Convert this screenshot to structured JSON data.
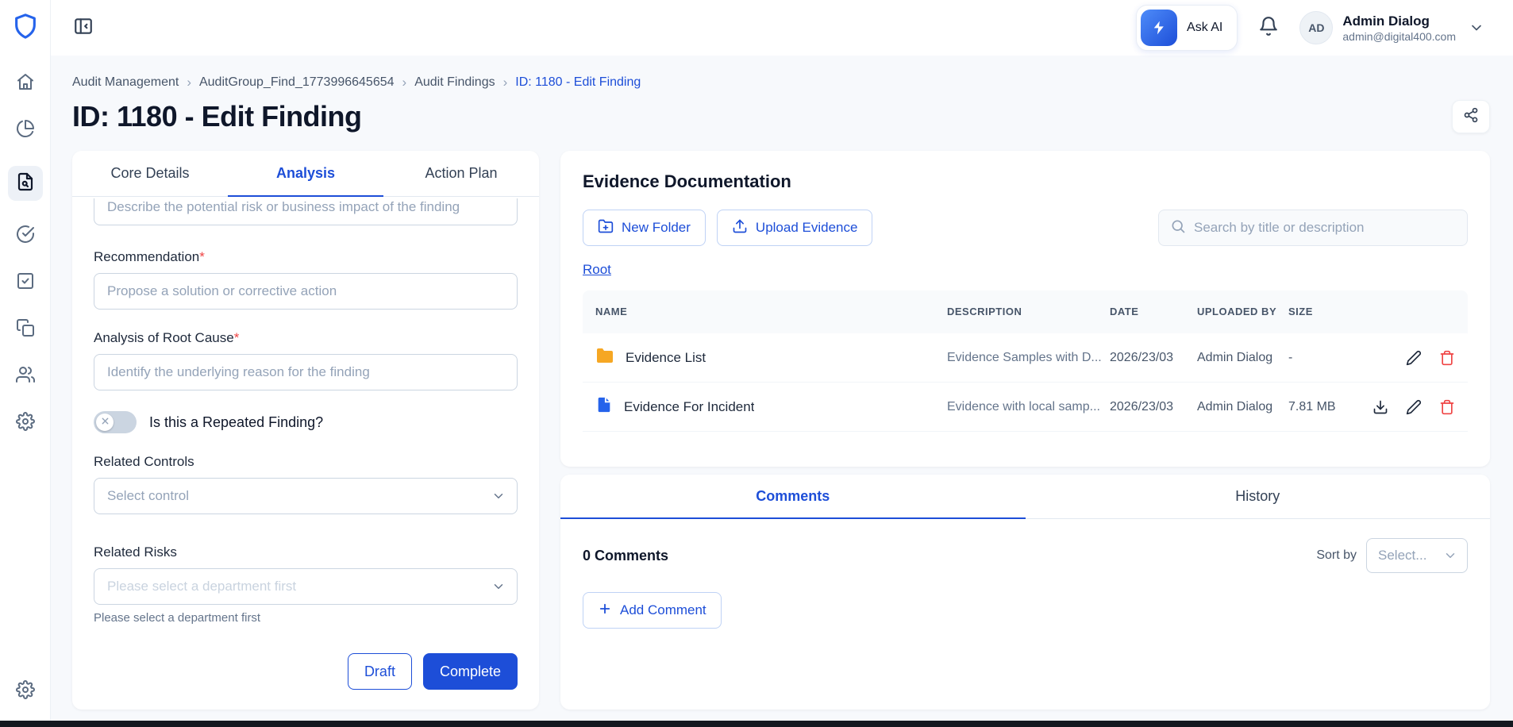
{
  "colors": {
    "accent": "#1d4ed8",
    "danger": "#ef4444",
    "folder_icon": "#f6a723",
    "file_icon": "#2563eb"
  },
  "topbar": {
    "ask_ai_label": "Ask AI",
    "user": {
      "initials": "AD",
      "name": "Admin Dialog",
      "email": "admin@digital400.com"
    }
  },
  "sidebar": {
    "items": [
      "home",
      "dashboard",
      "audits",
      "approvals",
      "tasks",
      "library",
      "users",
      "settings"
    ],
    "footer_item": "support-settings"
  },
  "breadcrumb": {
    "sep": "›",
    "items": [
      "Audit Management",
      "AuditGroup_Find_1773996645654",
      "Audit Findings",
      "ID: 1180 - Edit Finding"
    ]
  },
  "page": {
    "title": "ID: 1180 - Edit Finding"
  },
  "form": {
    "required_marker": "*",
    "tabs": [
      {
        "label": "Core Details"
      },
      {
        "label": "Analysis"
      },
      {
        "label": "Action Plan"
      }
    ],
    "impact_placeholder": "Describe the potential risk or business impact of the finding",
    "recommendation_label": "Recommendation",
    "recommendation_placeholder": "Propose a solution or corrective action",
    "root_cause_label": "Analysis of Root Cause",
    "root_cause_placeholder": "Identify the underlying reason for the finding",
    "repeated_toggle_label": "Is this a Repeated Finding?",
    "related_controls_label": "Related Controls",
    "related_controls_placeholder": "Select control",
    "related_risks_label": "Related Risks",
    "related_risks_placeholder": "Please select a department first",
    "related_risks_helper": "Please select a department first",
    "draft_button": "Draft",
    "complete_button": "Complete"
  },
  "evidence": {
    "title": "Evidence Documentation",
    "new_folder_button": "New Folder",
    "upload_button": "Upload Evidence",
    "search_placeholder": "Search by title or description",
    "root_link": "Root",
    "columns": {
      "name": "NAME",
      "description": "DESCRIPTION",
      "date": "DATE",
      "uploaded_by": "UPLOADED BY",
      "size": "SIZE"
    },
    "rows": [
      {
        "type": "folder",
        "name": "Evidence List",
        "description": "Evidence Samples with D...",
        "date": "2026/23/03",
        "uploaded_by": "Admin Dialog",
        "size": "-"
      },
      {
        "type": "file",
        "name": "Evidence For Incident",
        "description": "Evidence with local samp...",
        "date": "2026/23/03",
        "uploaded_by": "Admin Dialog",
        "size": "7.81 MB"
      }
    ]
  },
  "comments": {
    "tabs": [
      {
        "label": "Comments"
      },
      {
        "label": "History"
      }
    ],
    "count_label": "0 Comments",
    "sort_by_label": "Sort by",
    "sort_placeholder": "Select...",
    "add_comment_button": "Add Comment"
  }
}
